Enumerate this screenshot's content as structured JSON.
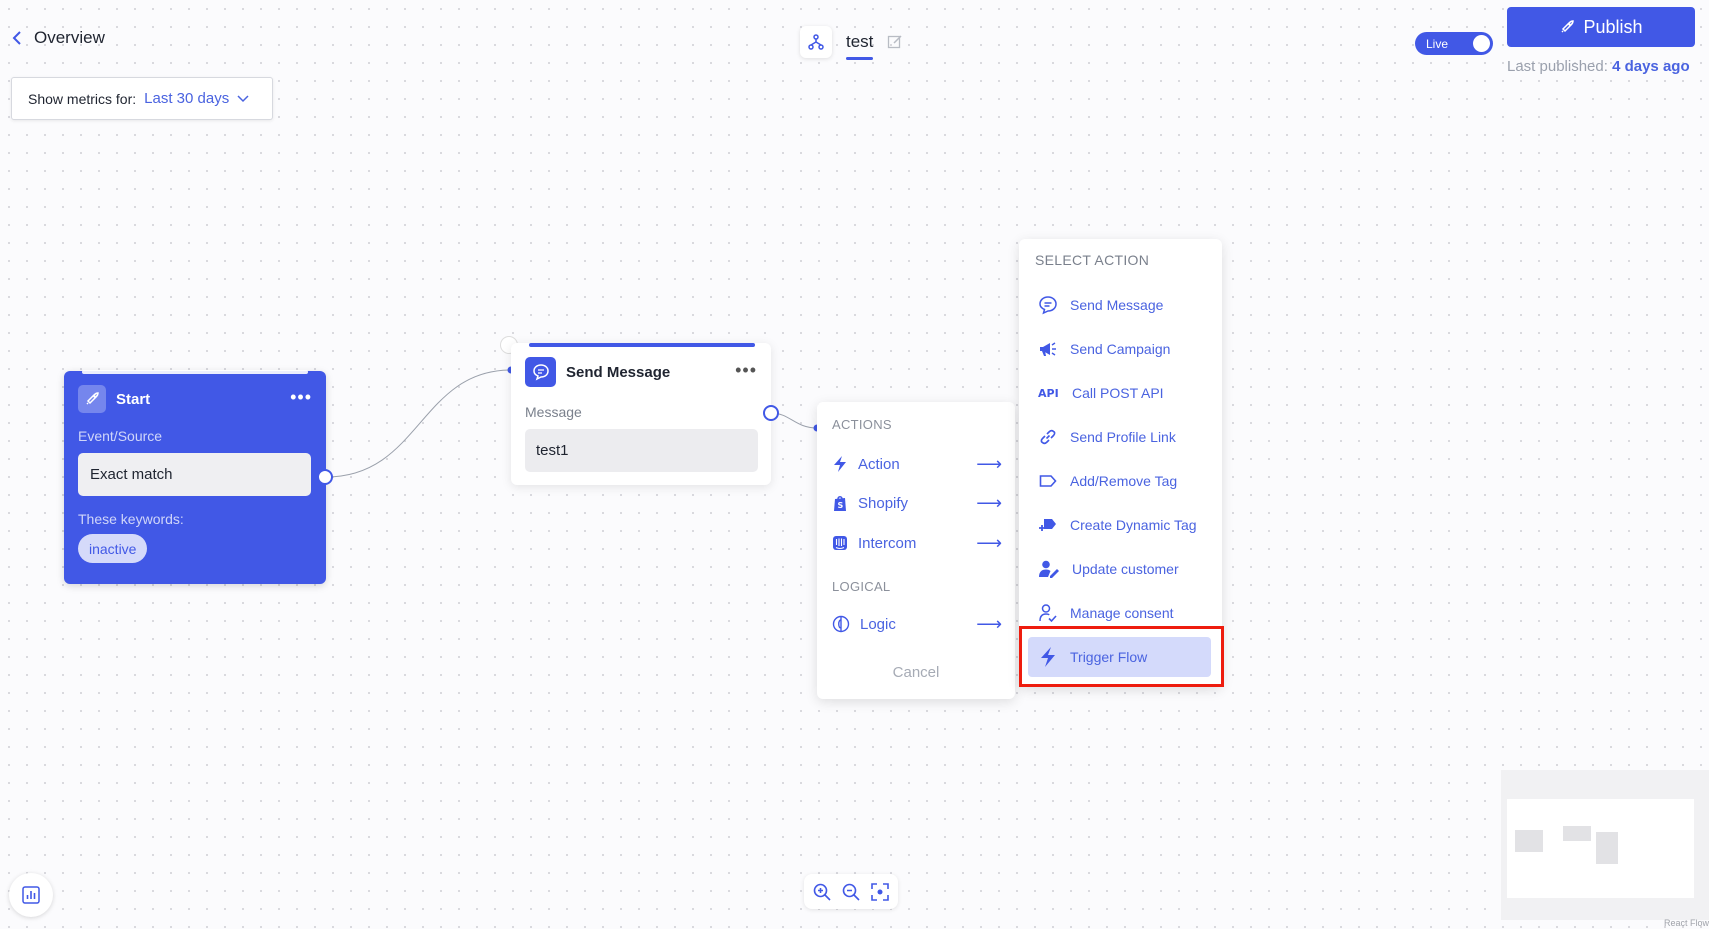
{
  "header": {
    "back_label": "Overview",
    "flow_name": "test",
    "live_label": "Live",
    "publish_label": "Publish",
    "last_published_label": "Last published:",
    "last_published_value": "4 days ago"
  },
  "metrics": {
    "label": "Show metrics for:",
    "value": "Last 30 days"
  },
  "start_node": {
    "title": "Start",
    "event_label": "Event/Source",
    "match_value": "Exact match",
    "keywords_label": "These keywords:",
    "keyword": "inactive"
  },
  "send_node": {
    "title": "Send Message",
    "message_label": "Message",
    "message_value": "test1"
  },
  "actions_menu": {
    "actions_heading": "ACTIONS",
    "actions": [
      {
        "label": "Action",
        "icon": "bolt-icon"
      },
      {
        "label": "Shopify",
        "icon": "shopify-icon"
      },
      {
        "label": "Intercom",
        "icon": "intercom-icon"
      }
    ],
    "logical_heading": "LOGICAL",
    "logical": [
      {
        "label": "Logic",
        "icon": "logic-icon"
      }
    ],
    "cancel_label": "Cancel"
  },
  "select_menu": {
    "heading": "SELECT ACTION",
    "items": [
      {
        "label": "Send Message",
        "icon": "chat-icon"
      },
      {
        "label": "Send Campaign",
        "icon": "megaphone-icon"
      },
      {
        "label": "Call POST API",
        "icon": "api-icon"
      },
      {
        "label": "Send Profile Link",
        "icon": "link-icon"
      },
      {
        "label": "Add/Remove Tag",
        "icon": "tag-icon"
      },
      {
        "label": "Create Dynamic Tag",
        "icon": "dynamic-tag-icon"
      },
      {
        "label": "Update customer",
        "icon": "user-edit-icon"
      },
      {
        "label": "Manage consent",
        "icon": "user-check-icon"
      },
      {
        "label": "Trigger Flow",
        "icon": "bolt-icon",
        "selected": true
      }
    ]
  },
  "footer": {
    "attribution": "React Flow"
  },
  "colors": {
    "accent": "#4158e6",
    "highlight": "#ee1c0e",
    "selected_bg": "#d4dafb"
  }
}
